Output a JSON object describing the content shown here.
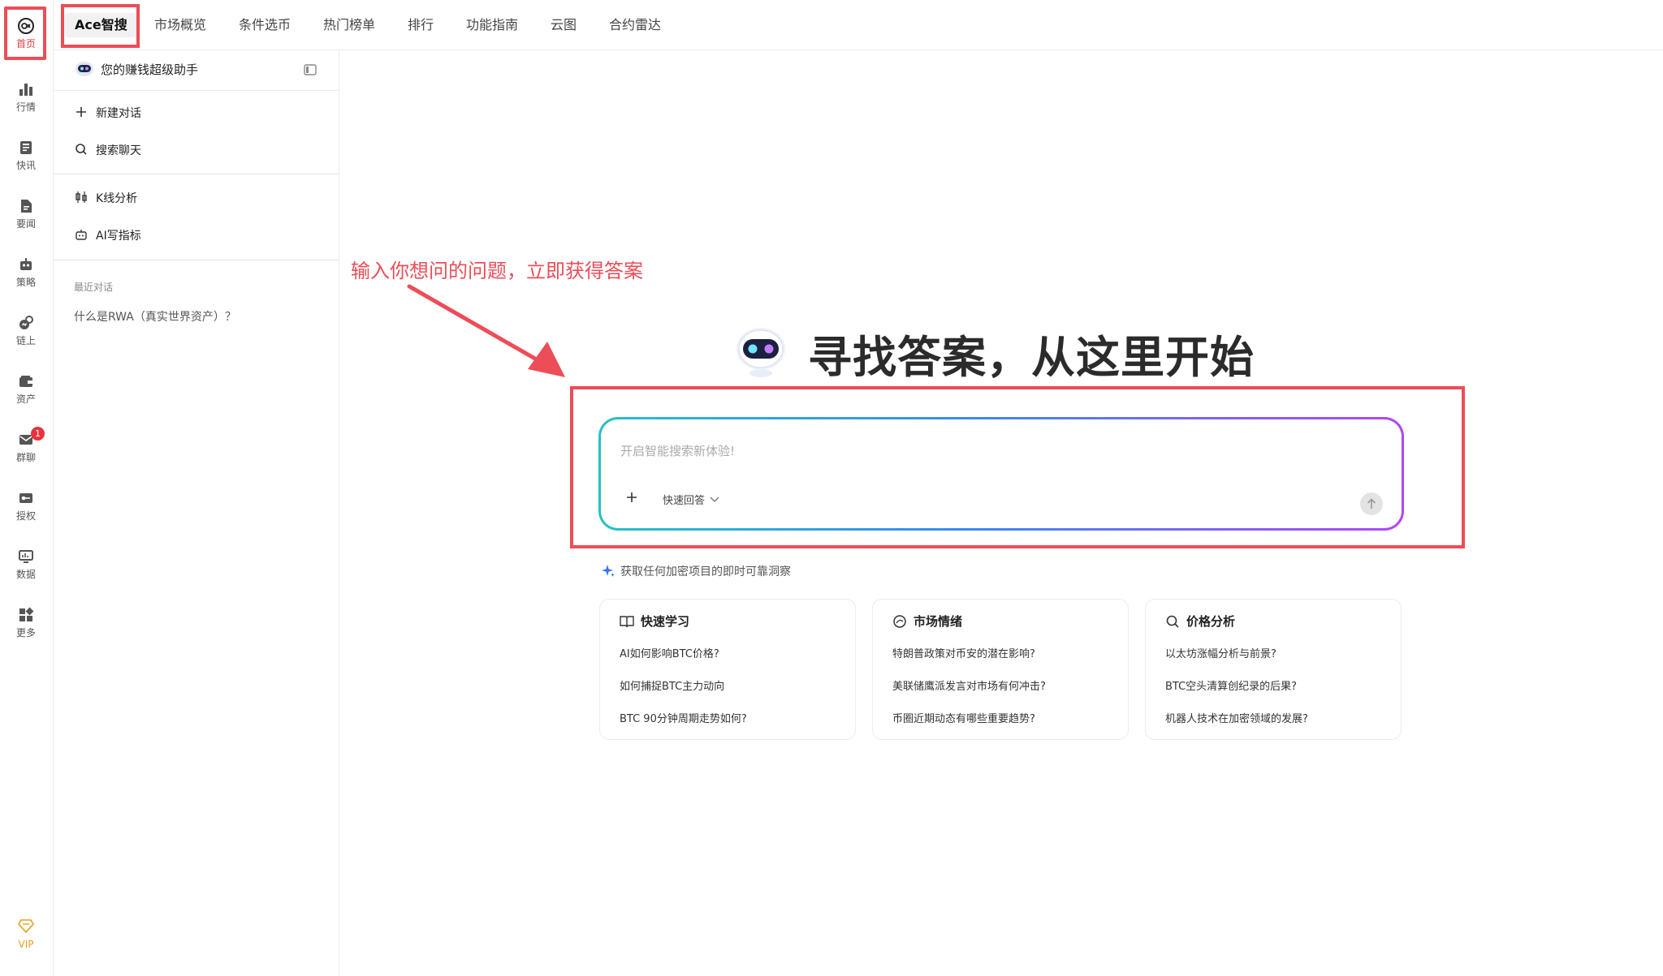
{
  "rail": {
    "home": "首页",
    "market": "行情",
    "flash": "快讯",
    "news": "要闻",
    "strategy": "策略",
    "onchain": "链上",
    "assets": "资产",
    "group_chat": "群聊",
    "group_chat_badge": "1",
    "auth": "授权",
    "data": "数据",
    "more": "更多",
    "vip": "VIP"
  },
  "tabs": {
    "ace": "Ace智搜",
    "overview": "市场概览",
    "screener": "条件选币",
    "hot": "热门榜单",
    "rank": "排行",
    "guide": "功能指南",
    "cloud": "云图",
    "radar": "合约雷达"
  },
  "sidebar": {
    "title": "您的赚钱超级助手",
    "new_chat": "新建对话",
    "search_chat": "搜索聊天",
    "kline": "K线分析",
    "ai_indicator": "AI写指标",
    "recent_label": "最近对话",
    "recent_item": "什么是RWA（真实世界资产）？"
  },
  "annotation": "输入你想问的问题，立即获得答案",
  "hero_title": "寻找答案，从这里开始",
  "input": {
    "placeholder": "开启智能搜索新体验!",
    "value": "",
    "quick_reply": "快速回答"
  },
  "insight": "获取任何加密项目的即时可靠洞察",
  "cards": {
    "learn": {
      "title": "快速学习",
      "questions": [
        "AI如何影响BTC价格?",
        "如何捕捉BTC主力动向",
        "BTC 90分钟周期走势如何?"
      ]
    },
    "sentiment": {
      "title": "市场情绪",
      "questions": [
        "特朗普政策对币安的潜在影响?",
        "美联储鹰派发言对市场有何冲击?",
        "币圈近期动态有哪些重要趋势?"
      ]
    },
    "price": {
      "title": "价格分析",
      "questions": [
        "以太坊涨幅分析与前景?",
        "BTC空头清算创纪录的后果?",
        "机器人技术在加密领域的发展?"
      ]
    }
  },
  "colors": {
    "highlight": "#ec4d57",
    "gradient_start": "#25c2c6",
    "gradient_mid": "#3a8bf0",
    "gradient_end": "#b146f2",
    "vip": "#e4a11b"
  }
}
